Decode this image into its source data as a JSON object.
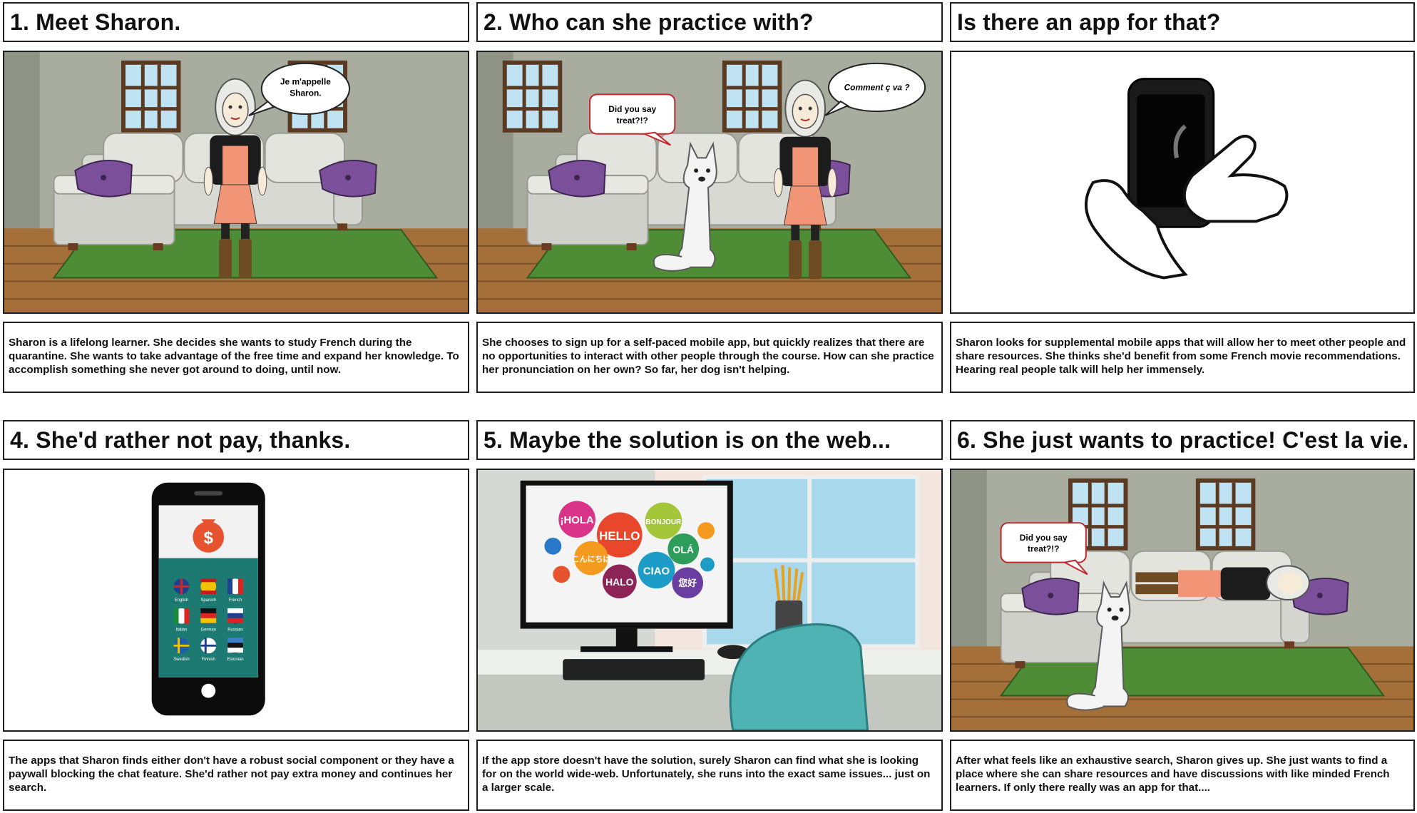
{
  "panels": [
    {
      "title": "1. Meet Sharon.",
      "bubble": [
        "Je m'appelle",
        "Sharon."
      ],
      "caption": "Sharon is a lifelong learner. She decides she wants to study French during the quarantine. She wants to take advantage of the free time and expand her knowledge. To accomplish something she never got around to doing, until now."
    },
    {
      "title": "2. Who can she practice with?",
      "bubble": [
        "Comment ç va ?"
      ],
      "dog_bubble": [
        "Did you say",
        "treat?!?"
      ],
      "caption": "She chooses to sign up for a self-paced mobile app, but quickly realizes that there are no opportunities to interact with other people through the course. How can she practice her pronunciation on her own? So far, her dog isn't helping."
    },
    {
      "title": "Is there an app for that?",
      "caption": "Sharon looks for supplemental mobile apps that will allow her to meet other people and share resources. She thinks she'd benefit from some French movie recommendations. Hearing real people talk will help her immensely."
    },
    {
      "title": "4. She'd rather not pay, thanks.",
      "languages": [
        "English",
        "Spanish",
        "French",
        "Italian",
        "German",
        "Russian",
        "Swedish",
        "Finnish",
        "Estonian"
      ],
      "caption": "The apps that Sharon finds either don't have a robust social component or they have a paywall blocking the chat feature. She'd rather not pay extra money and continues her search."
    },
    {
      "title": "5. Maybe the solution is on the web...",
      "greetings": [
        "¡HOLA",
        "HELLO",
        "BONJOUR",
        "OLÁ",
        "こんにちは",
        "CIAO",
        "HALO",
        "您好"
      ],
      "caption": "If the app store doesn't have the solution, surely Sharon can find what she is looking for on the world wide-web. Unfortunately, she runs into the exact same issues... just on a larger scale."
    },
    {
      "title": "6. She just wants to practice! C'est la vie.",
      "dog_bubble": [
        "Did you say",
        "treat?!?"
      ],
      "caption": "After what feels like an exhaustive search, Sharon gives up. She just wants to find a place where she can share resources and have discussions with like minded French learners. If only there really was an app for that...."
    }
  ],
  "colors": {
    "wall": "#a9ad9f",
    "floor": "#a56f3a",
    "rug": "#4e8c36",
    "sofa": "#d8d8d2",
    "pillow": "#7b4f99",
    "dress": "#f29476"
  }
}
